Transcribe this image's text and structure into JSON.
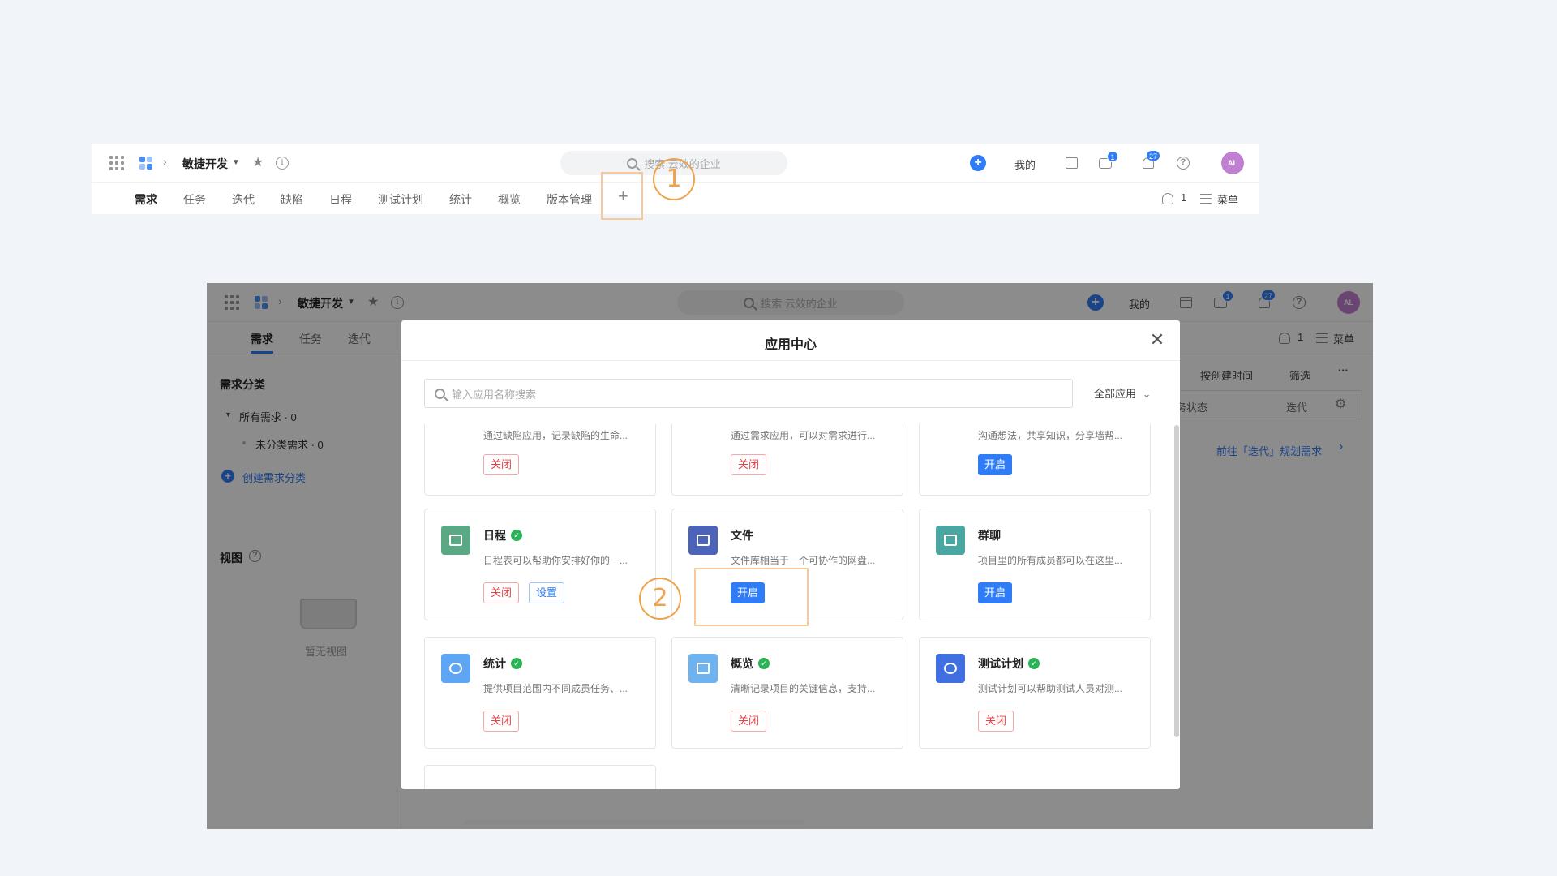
{
  "header": {
    "project_name": "敏捷开发",
    "search_placeholder": "搜索 云效的企业",
    "mine_label": "我的",
    "chat_badge": "1",
    "notify_badge": "27",
    "avatar_initials": "AL"
  },
  "tabs": [
    "需求",
    "任务",
    "迭代",
    "缺陷",
    "日程",
    "测试计划",
    "统计",
    "概览",
    "版本管理"
  ],
  "tab_plus": "+",
  "right_actions": {
    "member_count": "1",
    "menu_label": "菜单"
  },
  "steps": {
    "one": "1",
    "two": "2"
  },
  "bottom": {
    "tabs": [
      "需求",
      "任务",
      "迭代"
    ],
    "sidebar": {
      "category_title": "需求分类",
      "all_label": "所有需求 · 0",
      "uncategorized_label": "未分类需求 · 0",
      "create_label": "创建需求分类",
      "view_title": "视图",
      "empty_view": "暂无视图"
    },
    "right": {
      "sort_label": "按创建时间",
      "filter_label": "筛选",
      "more": "···",
      "col_status": "务状态",
      "col_iter": "迭代",
      "plan_link": "前往「迭代」规划需求"
    }
  },
  "modal": {
    "title": "应用中心",
    "search_placeholder": "输入应用名称搜索",
    "filter_label": "全部应用",
    "close_label": "关闭",
    "open_label": "开启",
    "setting_label": "设置",
    "top_row_desc": [
      "通过缺陷应用，记录缺陷的生命...",
      "通过需求应用，可以对需求进行...",
      "沟通想法，共享知识，分享墙帮..."
    ],
    "apps": [
      {
        "name": "日程",
        "desc": "日程表可以帮助你安排好你的一...",
        "color": "#5aa884"
      },
      {
        "name": "文件",
        "desc": "文件库相当于一个可协作的网盘...",
        "color": "#4b63b8"
      },
      {
        "name": "群聊",
        "desc": "项目里的所有成员都可以在这里...",
        "color": "#4aa6a0"
      },
      {
        "name": "统计",
        "desc": "提供项目范围内不同成员任务、...",
        "color": "#5ea6f3"
      },
      {
        "name": "概览",
        "desc": "清晰记录项目的关键信息，支持...",
        "color": "#6fb2f0"
      },
      {
        "name": "测试计划",
        "desc": "测试计划可以帮助测试人员对测...",
        "color": "#3f6fe0"
      }
    ]
  },
  "colors": {
    "primary": "#2f7cf6",
    "danger": "#e04545",
    "success": "#2db257",
    "annotation": "#f0a24a"
  }
}
